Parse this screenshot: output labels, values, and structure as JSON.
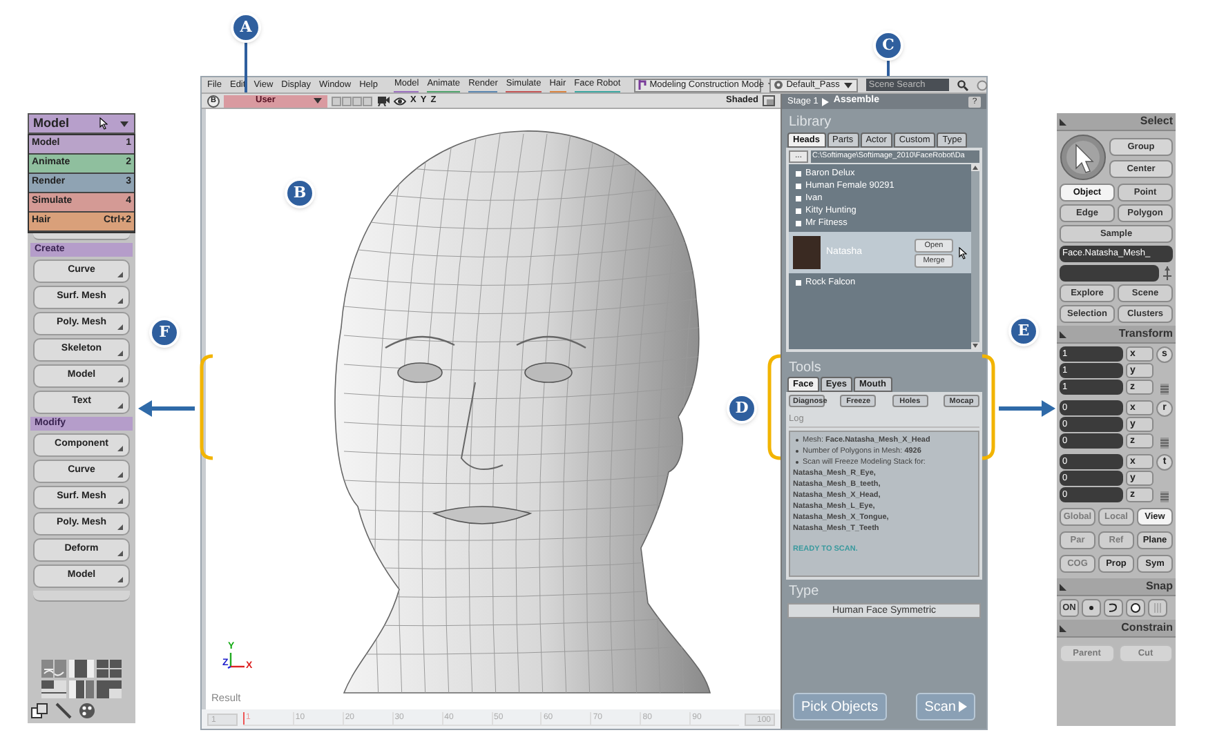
{
  "callouts": [
    {
      "label": "A"
    },
    {
      "label": "B"
    },
    {
      "label": "C"
    },
    {
      "label": "D"
    },
    {
      "label": "E"
    },
    {
      "label": "F"
    }
  ],
  "main_window": {
    "menu": [
      {
        "label": "File"
      },
      {
        "label": "Edit"
      },
      {
        "label": "View"
      },
      {
        "label": "Display"
      },
      {
        "label": "Window"
      },
      {
        "label": "Help"
      }
    ],
    "modules": [
      {
        "label": "Model",
        "color": "#9b6fc0"
      },
      {
        "label": "Animate",
        "color": "#4fa36b"
      },
      {
        "label": "Render",
        "color": "#5b86b0"
      },
      {
        "label": "Simulate",
        "color": "#c45555"
      },
      {
        "label": "Hair",
        "color": "#d9823f"
      },
      {
        "label": "Face Robot",
        "color": "#3aa6a0"
      }
    ],
    "construction_mode": "Modeling Construction Mode",
    "pass": "Default_Pass",
    "search": {
      "placeholder": "Scene Search"
    },
    "viewport": {
      "view_button": "B",
      "camera": "User",
      "axes": [
        "X",
        "Y",
        "Z"
      ],
      "display": "Shaded",
      "axis_gizmo": [
        "Y",
        "Z",
        "X"
      ],
      "label": "Result"
    },
    "timeline": {
      "start": "1",
      "ticks": [
        "1",
        "10",
        "20",
        "30",
        "40",
        "50",
        "60",
        "70",
        "80",
        "90"
      ],
      "end": "100"
    },
    "face_robot": {
      "breadcrumb": [
        "Stage 1",
        "Assemble"
      ],
      "help": "?",
      "library": {
        "title": "Library",
        "tabs": [
          {
            "label": "Heads",
            "selected": true
          },
          {
            "label": "Parts",
            "selected": false
          },
          {
            "label": "Actor",
            "selected": false
          },
          {
            "label": "Custom",
            "selected": false
          },
          {
            "label": "Type",
            "selected": false
          }
        ],
        "browse": "...",
        "path": "C:\\Softimage\\Softimage_2010\\FaceRobot\\Da",
        "items": [
          {
            "name": "Baron Delux",
            "selected": false
          },
          {
            "name": "Human Female 90291",
            "selected": false
          },
          {
            "name": "Ivan",
            "selected": false
          },
          {
            "name": "Kitty Hunting",
            "selected": false
          },
          {
            "name": "Mr Fitness",
            "selected": false
          },
          {
            "name": "Natasha",
            "selected": true,
            "buttons": [
              "Open",
              "Merge"
            ]
          },
          {
            "name": "Rock Falcon",
            "selected": false
          }
        ]
      },
      "tools": {
        "title": "Tools",
        "tabs": [
          {
            "label": "Face",
            "selected": true
          },
          {
            "label": "Eyes",
            "selected": false
          },
          {
            "label": "Mouth",
            "selected": false
          }
        ],
        "buttons": [
          "Diagnose",
          "Freeze",
          "Holes",
          "Mocap"
        ],
        "log_title": "Log",
        "log": [
          {
            "kind": "bullet",
            "text": "Mesh: **Face.Natasha_Mesh_X_Head**"
          },
          {
            "kind": "bullet",
            "text": "Number of Polygons in Mesh: **4926**"
          },
          {
            "kind": "bullet",
            "text": "Scan will Freeze Modeling Stack for:"
          },
          {
            "kind": "bold",
            "text": "Natasha_Mesh_R_Eye,"
          },
          {
            "kind": "bold",
            "text": "Natasha_Mesh_B_teeth,"
          },
          {
            "kind": "bold",
            "text": "Natasha_Mesh_X_Head,"
          },
          {
            "kind": "bold",
            "text": "Natasha_Mesh_L_Eye,"
          },
          {
            "kind": "bold",
            "text": "Natasha_Mesh_X_Tongue,"
          },
          {
            "kind": "bold",
            "text": "Natasha_Mesh_T_Teeth"
          },
          {
            "kind": "status",
            "text": "READY TO SCAN."
          }
        ]
      },
      "type": {
        "title": "Type",
        "value": "Human Face Symmetric"
      },
      "buttons": [
        {
          "kind": "plain",
          "label": "Pick Objects"
        },
        {
          "kind": "play",
          "label": "Scan"
        }
      ]
    }
  },
  "left_panel": {
    "module": "Model",
    "menu": [
      {
        "label": "Model",
        "shortcut": "1",
        "color": "#b9a3c9"
      },
      {
        "label": "Animate",
        "shortcut": "2",
        "color": "#8fbf9e"
      },
      {
        "label": "Render",
        "shortcut": "3",
        "color": "#8fa3b3"
      },
      {
        "label": "Simulate",
        "shortcut": "4",
        "color": "#d49a95"
      },
      {
        "label": "Hair",
        "shortcut": "Ctrl+2",
        "color": "#d9a07a"
      }
    ],
    "sections": [
      {
        "title": "Create",
        "buttons": [
          "Curve",
          "Surf. Mesh",
          "Poly. Mesh",
          "Skeleton",
          "Model",
          "Text"
        ]
      },
      {
        "title": "Modify",
        "buttons": [
          "Component",
          "Curve",
          "Surf. Mesh",
          "Poly. Mesh",
          "Deform",
          "Model"
        ]
      }
    ]
  },
  "right_panel": {
    "select": {
      "title": "Select",
      "group_buttons": [
        "Group",
        "Center"
      ],
      "components": [
        {
          "label": "Object",
          "selected": true
        },
        {
          "label": "Point",
          "selected": false
        },
        {
          "label": "Edge",
          "selected": false
        },
        {
          "label": "Polygon",
          "selected": false
        }
      ],
      "sample": "Sample",
      "selection": "Face.Natasha_Mesh_",
      "explore": [
        "Explore",
        "Scene",
        "Selection",
        "Clusters"
      ]
    },
    "transform": {
      "title": "Transform",
      "groups": [
        {
          "button": "s",
          "rows": [
            {
              "value": "1",
              "axis": "x"
            },
            {
              "value": "1",
              "axis": "y"
            },
            {
              "value": "1",
              "axis": "z"
            }
          ]
        },
        {
          "button": "r",
          "rows": [
            {
              "value": "0",
              "axis": "x"
            },
            {
              "value": "0",
              "axis": "y"
            },
            {
              "value": "0",
              "axis": "z"
            }
          ]
        },
        {
          "button": "t",
          "rows": [
            {
              "value": "0",
              "axis": "x"
            },
            {
              "value": "0",
              "axis": "y"
            },
            {
              "value": "0",
              "axis": "z"
            }
          ]
        }
      ],
      "modes": [
        [
          {
            "label": "Global",
            "selected": false,
            "disabled": true
          },
          {
            "label": "Local",
            "selected": false,
            "disabled": true
          },
          {
            "label": "View",
            "selected": true,
            "disabled": false
          }
        ],
        [
          {
            "label": "Par",
            "selected": false,
            "disabled": true
          },
          {
            "label": "Ref",
            "selected": false,
            "disabled": true
          },
          {
            "label": "Plane",
            "selected": false,
            "disabled": false
          }
        ],
        [
          {
            "label": "COG",
            "selected": false,
            "disabled": true
          },
          {
            "label": "Prop",
            "selected": false,
            "disabled": false
          },
          {
            "label": "Sym",
            "selected": false,
            "disabled": false
          }
        ]
      ]
    },
    "snap": {
      "title": "Snap",
      "toggle": "ON"
    },
    "constrain": {
      "title": "Constrain",
      "buttons": [
        {
          "label": "Parent",
          "disabled": true
        },
        {
          "label": "Cut",
          "disabled": true
        }
      ]
    }
  }
}
